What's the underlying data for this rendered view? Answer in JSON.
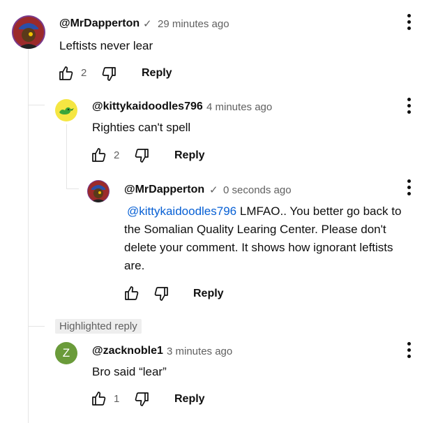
{
  "comments": [
    {
      "author": "@MrDapperton",
      "verified_mark": "✓",
      "time": "29 minutes ago",
      "text": "Leftists never lear",
      "likes": "2",
      "reply_label": "Reply"
    },
    {
      "author": "@kittykaidoodles796",
      "time": "4 minutes ago",
      "text": "Righties can't spell",
      "likes": "2",
      "reply_label": "Reply"
    },
    {
      "author": "@MrDapperton",
      "verified_mark": "✓",
      "time": "0 seconds ago",
      "mention": "@kittykaidoodles796",
      "text_line1": " LMFAO.. You better go back to",
      "text_line2": "the Somalian Quality Learing Center. Please don't",
      "text_line3": "delete your comment. It shows how ignorant leftists",
      "text_line4": "are.",
      "reply_label": "Reply"
    },
    {
      "highlight_label": "Highlighted reply",
      "avatar_letter": "Z",
      "author": "@zacknoble1",
      "time": "3 minutes ago",
      "text": "Bro said “lear”",
      "likes": "1",
      "reply_label": "Reply"
    }
  ],
  "colors": {
    "text": "#0f0f0f",
    "secondary": "#606060",
    "link": "#065fd4",
    "zack_avatar": "#6a9b3a",
    "kitty_avatar": "#f5e642"
  },
  "icons": [
    "thumbs-up-icon",
    "thumbs-down-icon",
    "more-vert-icon",
    "verified-check-icon"
  ]
}
